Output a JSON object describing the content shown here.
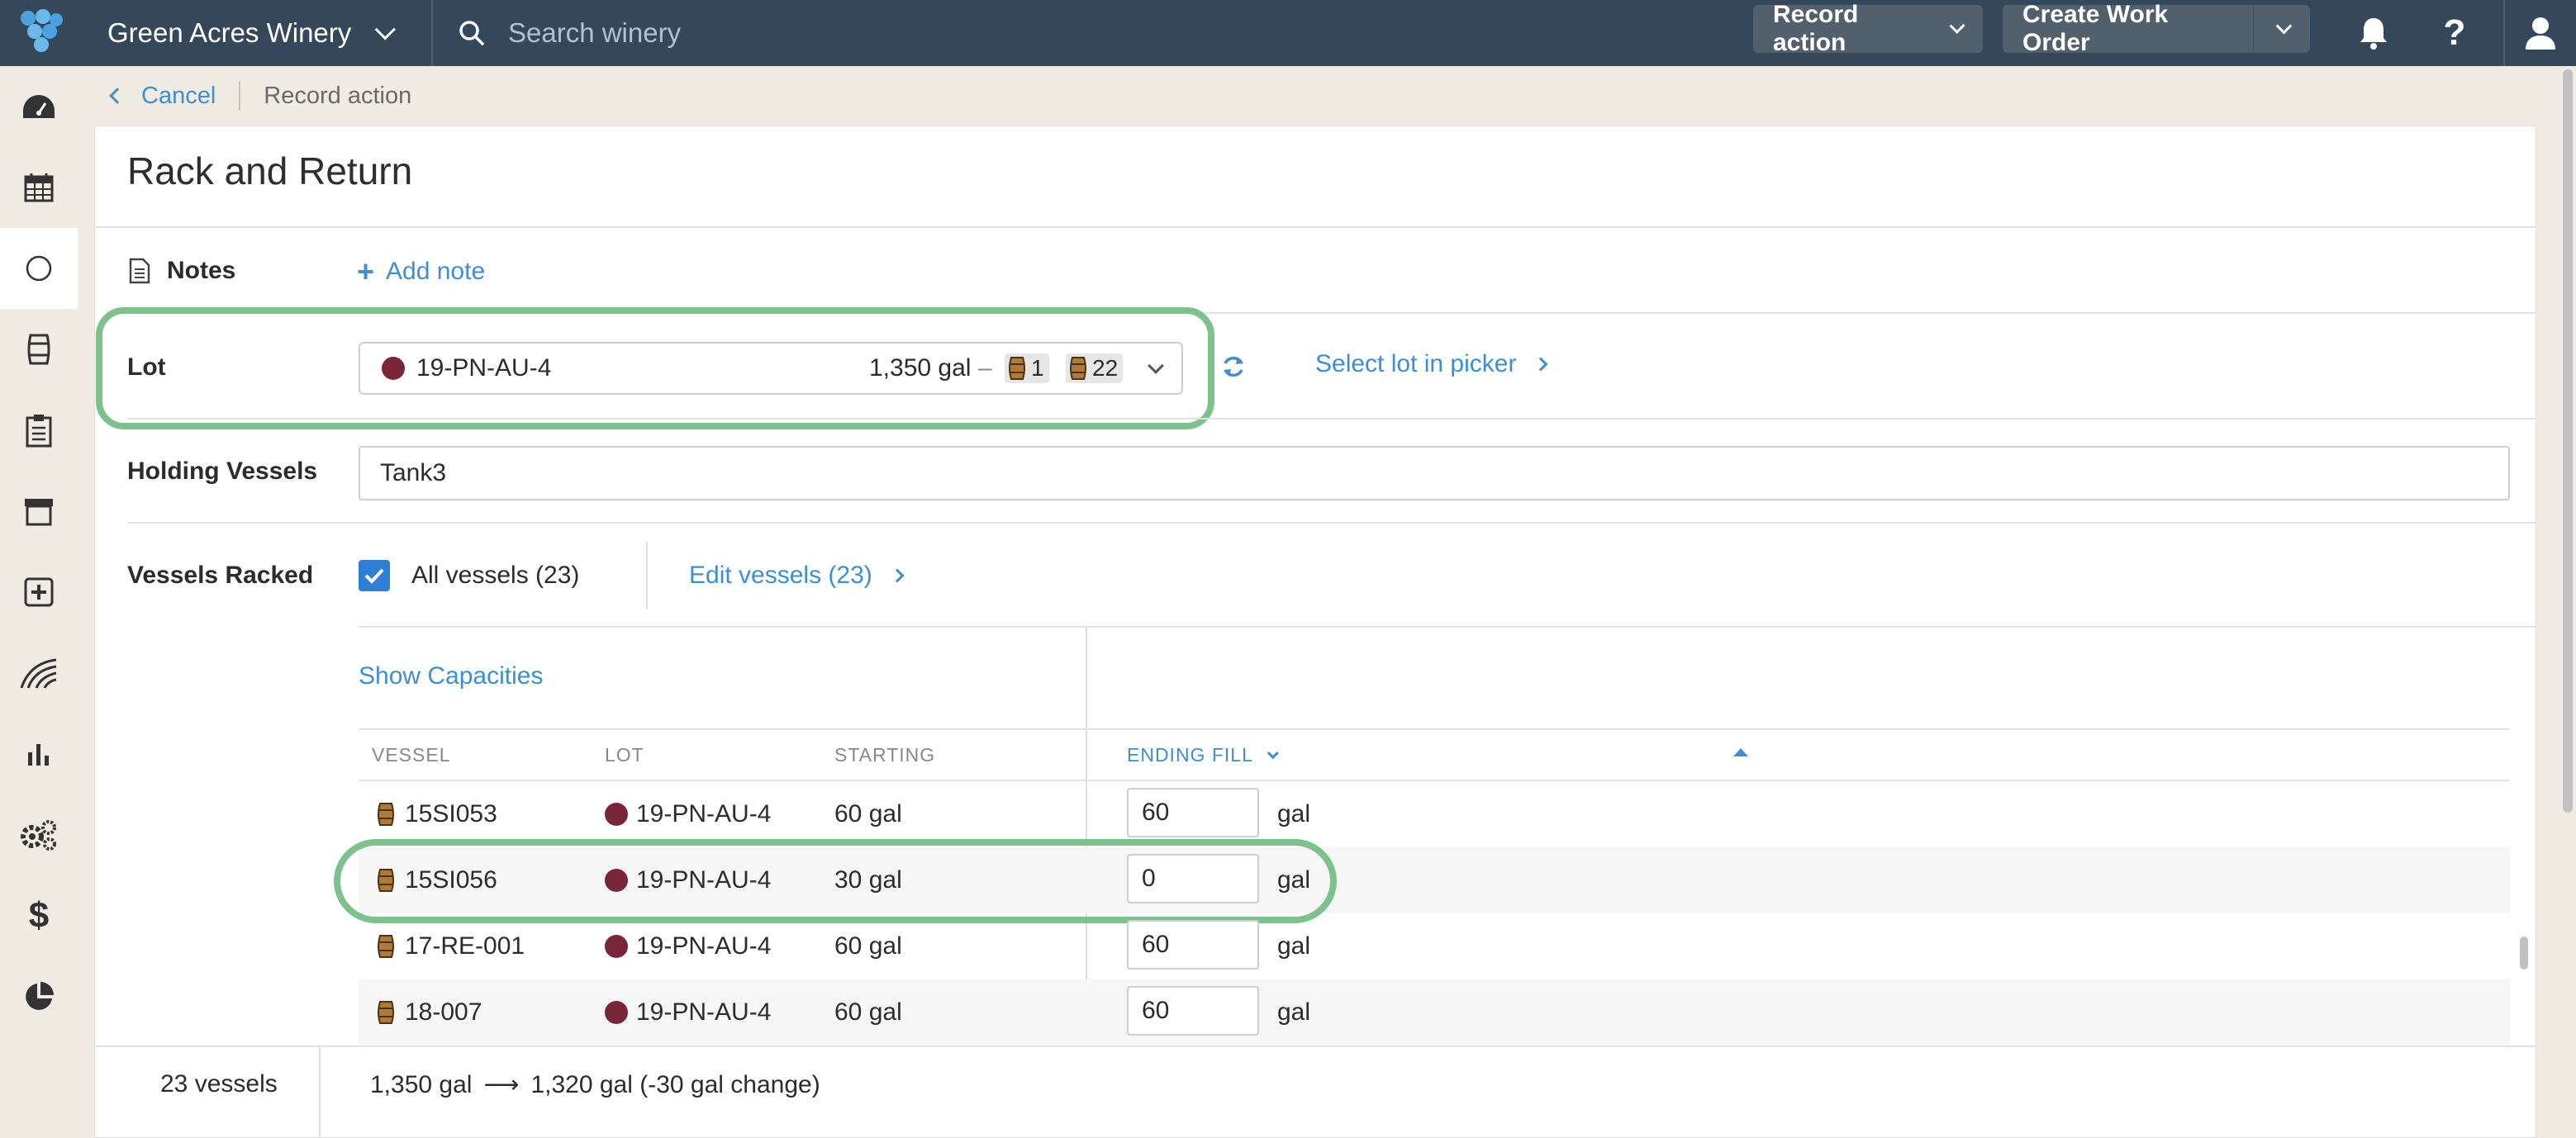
{
  "header": {
    "org_name": "Green Acres Winery",
    "search_placeholder": "Search winery",
    "record_action_label": "Record action",
    "create_work_order_label": "Create Work Order"
  },
  "sidebar": {
    "items": [
      {
        "icon": "dashboard-icon"
      },
      {
        "icon": "calendar-icon"
      },
      {
        "icon": "circle-icon",
        "active": true
      },
      {
        "icon": "barrel-icon"
      },
      {
        "icon": "clipboard-icon"
      },
      {
        "icon": "archive-icon"
      },
      {
        "icon": "add-box-icon"
      },
      {
        "icon": "vineyard-icon"
      },
      {
        "icon": "bar-chart-icon"
      },
      {
        "icon": "gears-icon"
      },
      {
        "icon": "dollar-icon"
      },
      {
        "icon": "pie-chart-icon"
      }
    ]
  },
  "breadcrumb": {
    "cancel_label": "Cancel",
    "current": "Record action"
  },
  "form": {
    "title": "Rack and Return",
    "notes_label": "Notes",
    "add_note_label": "Add note",
    "lot_label": "Lot",
    "lot": {
      "name": "19-PN-AU-4",
      "volume": "1,350 gal",
      "dash": "–",
      "barrel_count_1": "1",
      "barrel_count_2": "22",
      "color": "#7a2538"
    },
    "select_lot_picker_label": "Select lot in picker",
    "holding_vessels_label": "Holding Vessels",
    "holding_vessels_value": "Tank3",
    "vessels_racked_label": "Vessels Racked",
    "all_vessels_label": "All vessels (23)",
    "all_vessels_checked": true,
    "edit_vessels_label": "Edit vessels (23)",
    "show_capacities_label": "Show Capacities"
  },
  "table": {
    "headers": {
      "vessel": "VESSEL",
      "lot": "LOT",
      "starting": "STARTING",
      "ending_fill": "ENDING FILL"
    },
    "unit": "gal",
    "rows": [
      {
        "vessel": "15SI053",
        "lot": "19-PN-AU-4",
        "starting": "60 gal",
        "ending": "60"
      },
      {
        "vessel": "15SI056",
        "lot": "19-PN-AU-4",
        "starting": "30 gal",
        "ending": "0"
      },
      {
        "vessel": "17-RE-001",
        "lot": "19-PN-AU-4",
        "starting": "60 gal",
        "ending": "60"
      },
      {
        "vessel": "18-007",
        "lot": "19-PN-AU-4",
        "starting": "60 gal",
        "ending": "60"
      }
    ]
  },
  "footer": {
    "vessel_count": "23 vessels",
    "from_volume": "1,350 gal",
    "arrow": "⟶",
    "to_volume": "1,320 gal (-30 gal change)"
  },
  "colors": {
    "topbar": "#35475b",
    "accent": "#3d8ed3",
    "highlight": "#7dc28c",
    "lot_dot": "#7a2538"
  }
}
